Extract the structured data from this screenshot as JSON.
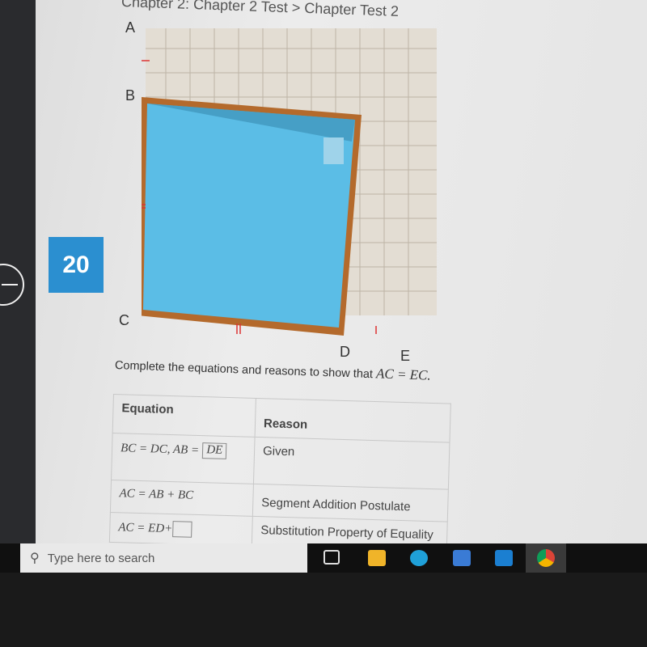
{
  "breadcrumb": "Chapter 2: Chapter 2 Test > Chapter Test 2",
  "question_number": "20",
  "figure": {
    "labels": [
      "A",
      "B",
      "C",
      "D",
      "E"
    ]
  },
  "prompt": {
    "text": "Complete the equations and reasons to show that ",
    "math": "AC = EC."
  },
  "table": {
    "headers": [
      "Equation",
      "Reason"
    ],
    "rows": [
      {
        "equation": "BC = DC,  AB =",
        "answer": "DE",
        "reason": "Given"
      },
      {
        "equation": "AC = AB + BC",
        "reason": "Segment Addition Postulate"
      },
      {
        "equation": "AC = ED+",
        "answer": "",
        "reason": "Substitution Property of Equality"
      }
    ]
  },
  "taskbar": {
    "search_placeholder": "Type here to search"
  },
  "colors": {
    "badge": "#2b8fd0",
    "pool": "#5bbde6",
    "deck": "#b46a2c"
  }
}
